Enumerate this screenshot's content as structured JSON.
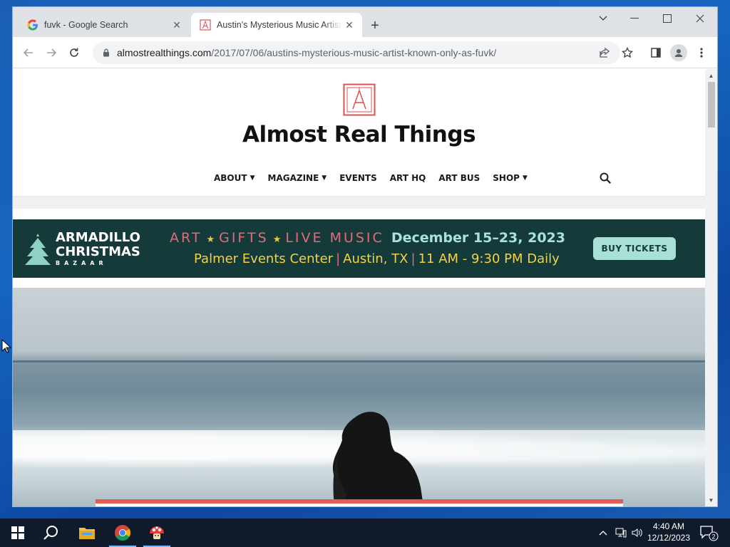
{
  "browser": {
    "tabs": [
      {
        "title": "fuvk - Google Search",
        "active": false
      },
      {
        "title": "Austin's Mysterious Music Artist Known Only as Fuvk",
        "active": true
      }
    ],
    "url_host": "almostrealthings.com",
    "url_path": "/2017/07/06/austins-mysterious-music-artist-known-only-as-fuvk/"
  },
  "site": {
    "title": "Almost Real Things",
    "nav": [
      {
        "label": "ABOUT",
        "dropdown": true
      },
      {
        "label": "MAGAZINE",
        "dropdown": true
      },
      {
        "label": "EVENTS",
        "dropdown": false
      },
      {
        "label": "ART HQ",
        "dropdown": false
      },
      {
        "label": "ART BUS",
        "dropdown": false
      },
      {
        "label": "SHOP",
        "dropdown": true
      }
    ]
  },
  "banner": {
    "brand_line1": "ARMADILLO",
    "brand_line2": "CHRISTMAS",
    "brand_line3": "BAZAAR",
    "features": [
      "ART",
      "GIFTS",
      "LIVE MUSIC"
    ],
    "dates": "December 15–23, 2023",
    "venue": "Palmer Events Center",
    "city": "Austin, TX",
    "hours": "11 AM - 9:30 PM Daily",
    "cta": "BUY TICKETS",
    "colors": {
      "background": "#143a3a",
      "pink": "#e86a7a",
      "yellow": "#f0d24a",
      "mint": "#a9e2dc"
    }
  },
  "taskbar": {
    "time": "4:40 AM",
    "date": "12/12/2023",
    "notifications": "2"
  }
}
